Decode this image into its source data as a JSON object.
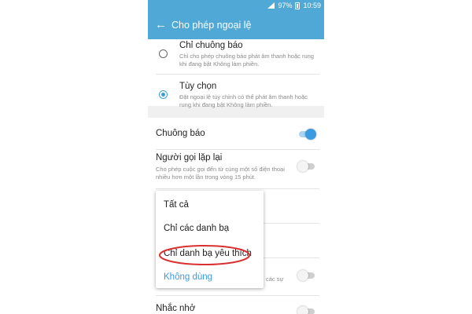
{
  "status_bar": {
    "battery": "97%",
    "time": "10:59",
    "signal_icon": "signal-icon",
    "battery_icon": "battery-icon"
  },
  "app_bar": {
    "title": "Cho phép ngoại lệ",
    "back_icon": "back-arrow-icon"
  },
  "options": [
    {
      "title": "Chỉ chuông báo",
      "subtitle": "Chỉ cho phép chuông báo phát âm thanh hoặc rung khi đang bật Không làm phiền.",
      "selected": false
    },
    {
      "title": "Tùy chọn",
      "subtitle": "Đặt ngoại lệ tùy chỉnh có thể phát âm thanh hoặc rung khi đang bật Không làm phiền.",
      "selected": true
    }
  ],
  "settings": {
    "alarms": {
      "title": "Chuông báo",
      "on": true
    },
    "repeat_callers": {
      "title": "Người gọi lặp lại",
      "subtitle": "Cho phép cuộc gọi đến từ cùng một số điện thoại nhiều hơn một lần trong vòng 15 phút.",
      "on": false
    },
    "partial_row": {
      "title_fragment": "u",
      "subtitle_fragment": "các sự",
      "on": false
    },
    "reminders": {
      "title": "Nhắc nhở",
      "on": false
    }
  },
  "dropdown": {
    "items": [
      "Tất cả",
      "Chỉ các danh bạ",
      "Chỉ danh bạ yêu thích",
      "Không dùng"
    ],
    "highlighted_index": 2,
    "accent_index": 3
  },
  "colors": {
    "accent": "#3b9be0",
    "app_bar": "#4fa8d6",
    "annotation": "#d9302f"
  }
}
